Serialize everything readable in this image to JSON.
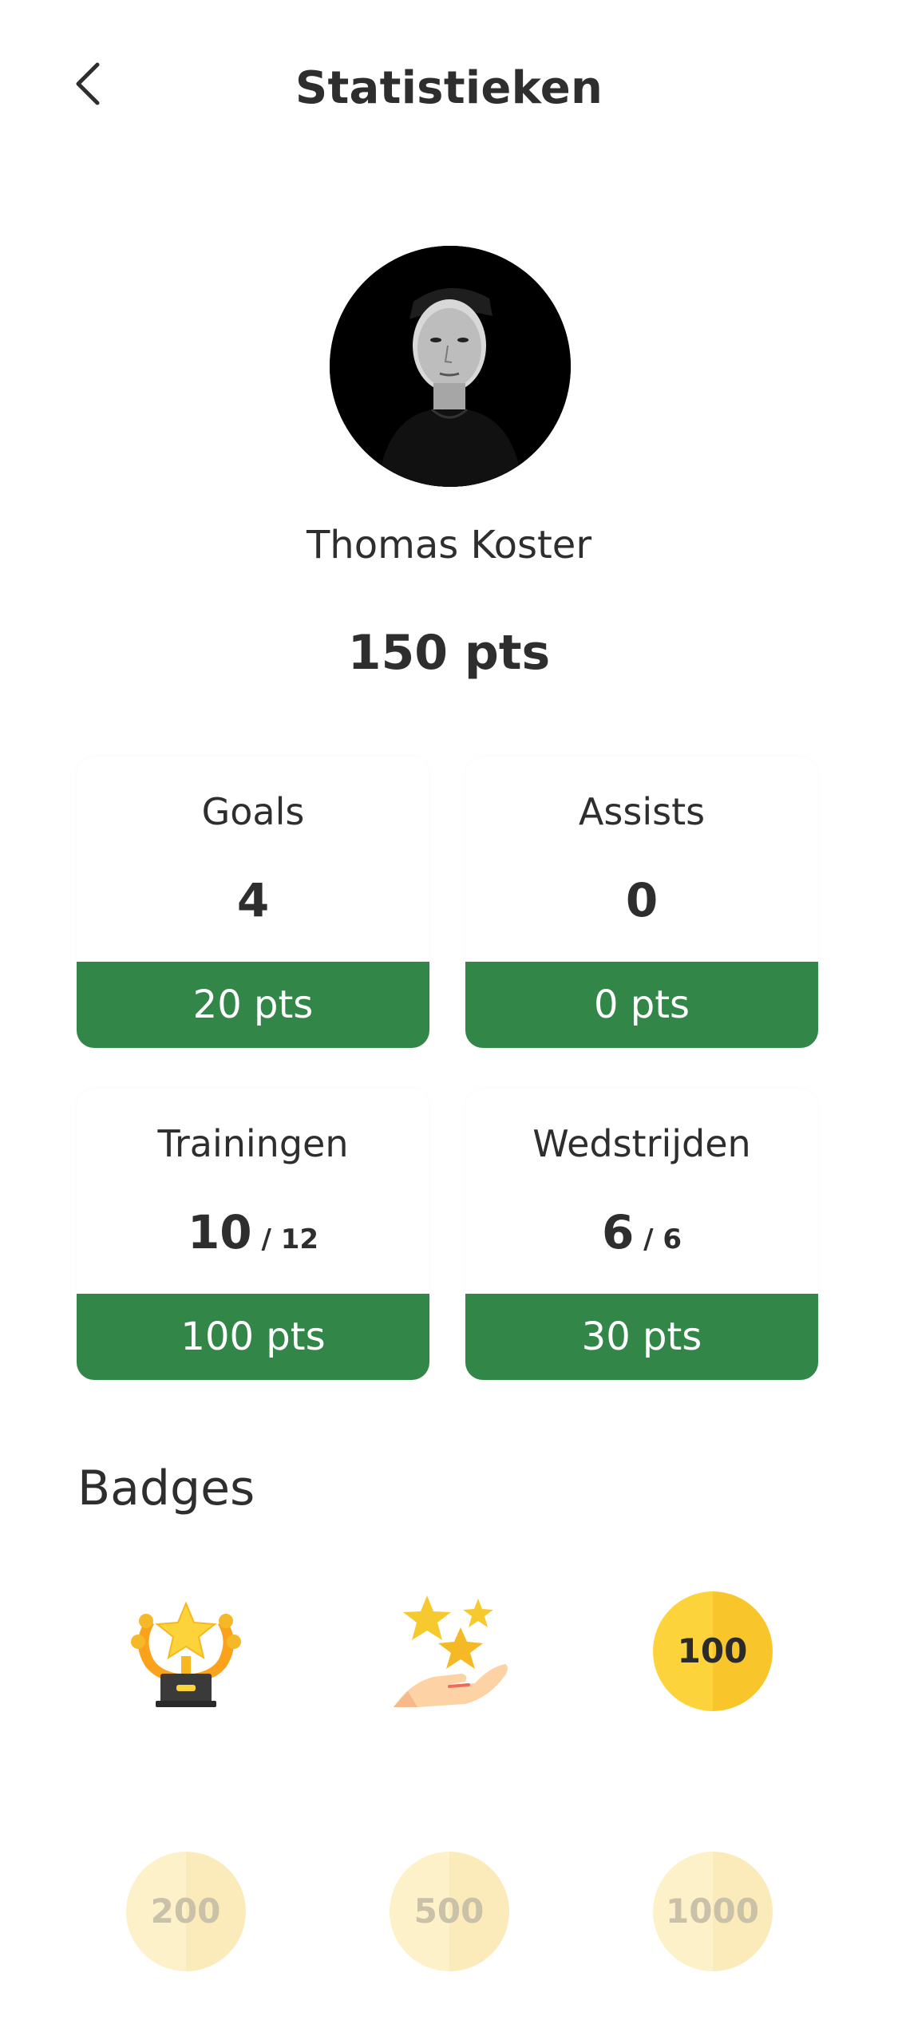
{
  "header": {
    "title": "Statistieken",
    "back_icon": "chevron-left-icon"
  },
  "player": {
    "name": "Thomas Koster",
    "total_points": "150 pts"
  },
  "stats": [
    {
      "label": "Goals",
      "value": "4",
      "of": "",
      "points": "20 pts"
    },
    {
      "label": "Assists",
      "value": "0",
      "of": "",
      "points": "0 pts"
    },
    {
      "label": "Trainingen",
      "value": "10",
      "of": " / 12",
      "points": "100 pts"
    },
    {
      "label": "Wedstrijden",
      "value": "6",
      "of": " / 6",
      "points": "30 pts"
    }
  ],
  "badges": {
    "title": "Badges",
    "items": [
      {
        "type": "trophy-icon",
        "earned": true
      },
      {
        "type": "stars-hand-icon",
        "earned": true
      },
      {
        "type": "coin",
        "label": "100",
        "earned": true
      },
      {
        "type": "coin",
        "label": "200",
        "earned": false
      },
      {
        "type": "coin",
        "label": "500",
        "earned": false
      },
      {
        "type": "coin",
        "label": "1000",
        "earned": false
      }
    ]
  },
  "colors": {
    "accent_green": "#328648",
    "coin_gold": "#fdd33b",
    "coin_locked": "#fdf1c9"
  }
}
